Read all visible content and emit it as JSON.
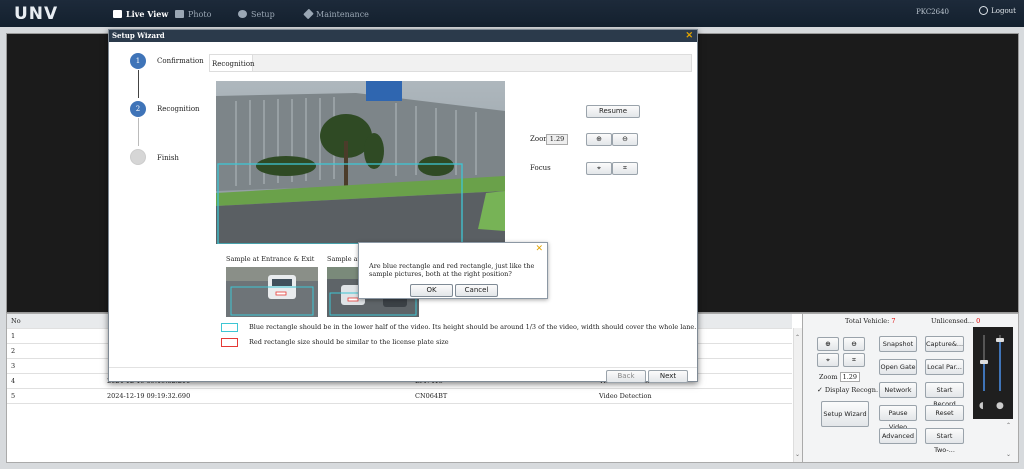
{
  "app": {
    "logo": "UNV",
    "user": "PKC2640",
    "logout_label": "Logout",
    "nav": [
      {
        "label": "Live View",
        "icon": "monitor-icon",
        "active": true
      },
      {
        "label": "Photo",
        "icon": "photo-icon",
        "active": false
      },
      {
        "label": "Setup",
        "icon": "gear-icon",
        "active": false
      },
      {
        "label": "Maintenance",
        "icon": "wrench-icon",
        "active": false
      }
    ]
  },
  "table": {
    "header_no": "No",
    "rows": [
      {
        "no": "1",
        "time": "",
        "plate": "",
        "type": ""
      },
      {
        "no": "2",
        "time": "",
        "plate": "",
        "type": ""
      },
      {
        "no": "3",
        "time": "",
        "plate": "",
        "type": ""
      },
      {
        "no": "4",
        "time": "2024-12-19 09:19:32.210",
        "plate": "EM7415",
        "type": "Video Detection"
      },
      {
        "no": "5",
        "time": "2024-12-19 09:19:32.690",
        "plate": "CN064BT",
        "type": "Video Detection"
      }
    ]
  },
  "panel": {
    "total_vehicle_label": "Total Vehicle:",
    "total_vehicle_value": "7",
    "unlicensed_label": "Unlicensed...",
    "unlicensed_value": "0",
    "zoom_label": "Zoom",
    "zoom_value": "1.29",
    "display_recog_label": "Display Recogn.",
    "buttons": {
      "snapshot": "Snapshot",
      "capture": "Capture&...",
      "open_gate": "Open Gate",
      "local_par": "Local Par...",
      "network": "Network",
      "start_record": "Start Record",
      "setup_wizard": "Setup Wizard",
      "pause_video": "Pause Video",
      "reset": "Reset",
      "advanced": "Advanced",
      "start_two": "Start Two-..."
    }
  },
  "wizard": {
    "title": "Setup Wizard",
    "steps": [
      {
        "num": "1",
        "label": "Confirmation"
      },
      {
        "num": "2",
        "label": "Recognition"
      },
      {
        "num": "",
        "label": "Finish"
      }
    ],
    "tab": "Recognition",
    "resume": "Resume",
    "zoom_label": "Zoom",
    "zoom_value": "1.29",
    "focus_label": "Focus",
    "sample_entrance": "Sample at Entrance & Exit",
    "sample_road": "Sample at Ro",
    "legend_blue": "Blue rectangle should be in the lower half of the video. Its height should be around 1/3 of the video, width should cover the whole lane.",
    "legend_red": "Red rectangle size should be similar to the license plate size",
    "back": "Back",
    "next": "Next"
  },
  "confirm": {
    "message": "Are blue rectangle and red rectangle, just like the sample pictures, both at the right position?",
    "ok": "OK",
    "cancel": "Cancel"
  },
  "colors": {
    "topbar": "#1b2634",
    "blue_rect": "#3ec6d4",
    "red_rect": "#e53935",
    "step_active": "#3f74b8",
    "step_inactive": "#d0d0d0"
  }
}
